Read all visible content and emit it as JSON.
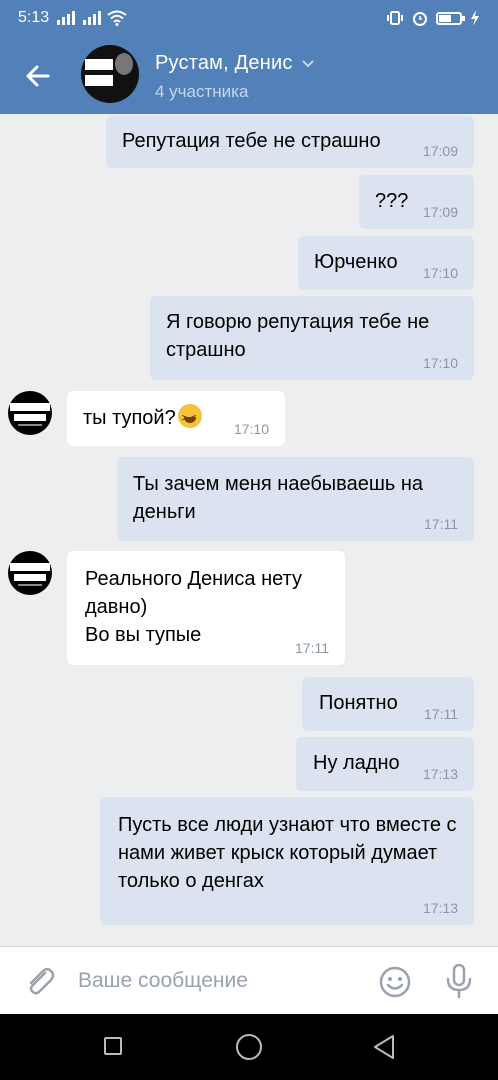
{
  "status": {
    "time": "5:13"
  },
  "header": {
    "title": "Рустам, Денис",
    "subtitle": "4 участника"
  },
  "messages": [
    {
      "text": "Репутация тебе не страшно",
      "time": "17:09"
    },
    {
      "text": "???",
      "time": "17:09"
    },
    {
      "text": "Юрченко",
      "time": "17:10"
    },
    {
      "text": "Я говорю репутация тебе не страшно",
      "time": "17:10"
    },
    {
      "text": "ты тупой?",
      "time": "17:10"
    },
    {
      "text": "Ты зачем меня наебываешь на деньги",
      "time": "17:11"
    },
    {
      "text": "Реального Дениса нету давно)\nВо вы тупые",
      "time": "17:11"
    },
    {
      "text": "Понятно",
      "time": "17:11"
    },
    {
      "text": "Ну ладно",
      "time": "17:13"
    },
    {
      "text": "Пусть все люди узнают что вместе с нами живет крыск который думает только о денгах",
      "time": "17:13"
    }
  ],
  "input": {
    "placeholder": "Ваше сообщение"
  },
  "colors": {
    "accent": "#5181b8",
    "outgoing": "#dae3ef",
    "incoming": "#ffffff",
    "background": "#edeef0"
  }
}
